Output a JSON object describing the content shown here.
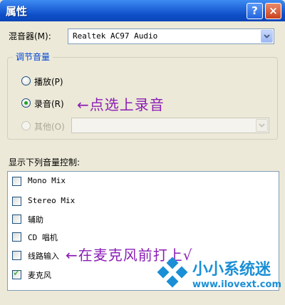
{
  "window": {
    "title": "属性",
    "help_label": "?",
    "close_label": "×"
  },
  "mixer": {
    "label": "混音器(M):",
    "value": "Realtek AC97 Audio"
  },
  "adjust_group": {
    "title": "调节音量",
    "options": [
      {
        "label": "播放(P)",
        "checked": false,
        "enabled": true
      },
      {
        "label": "录音(R)",
        "checked": true,
        "enabled": true
      },
      {
        "label": "其他(O)",
        "checked": false,
        "enabled": false
      }
    ]
  },
  "annotations": {
    "record": "←点选上录音",
    "mic": "←在麦克风前打上√"
  },
  "controls": {
    "heading": "显示下列音量控制:",
    "items": [
      {
        "label": "Mono Mix",
        "checked": false
      },
      {
        "label": "Stereo Mix",
        "checked": false
      },
      {
        "label": "辅助",
        "checked": false
      },
      {
        "label": "CD 唱机",
        "checked": false
      },
      {
        "label": "线路输入",
        "checked": false
      },
      {
        "label": "麦克风",
        "checked": true
      }
    ]
  },
  "watermark": {
    "text": "小小系统迷",
    "url": "www.ilovext.com"
  },
  "colors": {
    "titlebar": "#1f63d8",
    "annotation": "#8b1db5",
    "group_title": "#0046d5",
    "watermark": "#1a8fd6"
  }
}
